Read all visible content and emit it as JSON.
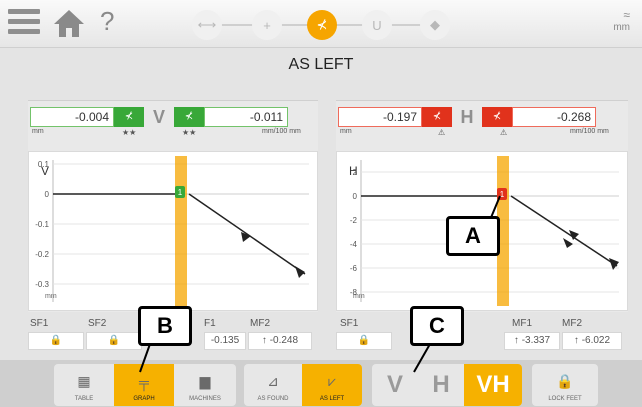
{
  "header": {
    "help": "?",
    "units": "mm",
    "steps": [
      "dimensions-icon",
      "sensor-position-icon",
      "results-icon",
      "coupling-icon",
      "settings-icon"
    ]
  },
  "title": "AS LEFT",
  "left_panel": {
    "value_left": "-0.004",
    "axis": "V",
    "value_right": "-0.011",
    "unit_left": "mm",
    "unit_right": "mm/100 mm",
    "stars_left": "★★",
    "stars_right": "★★",
    "plot_axis": "V",
    "plot_unit": "mm",
    "y_ticks": [
      "0.1",
      "0",
      "-0.1",
      "-0.2",
      "-0.3"
    ],
    "marker": "1"
  },
  "right_panel": {
    "value_left": "-0.197",
    "axis": "H",
    "value_right": "-0.268",
    "unit_left": "mm",
    "unit_right": "mm/100 mm",
    "warn_left": "⚠",
    "warn_right": "⚠",
    "plot_axis": "H",
    "plot_unit": "mm",
    "y_ticks": [
      "2",
      "0",
      "-2",
      "-4",
      "-6",
      "-8"
    ],
    "marker": "1"
  },
  "feet_left": {
    "sf1_label": "SF1",
    "sf2_label": "SF2",
    "mf1_label": "F1",
    "mf2_label": "MF2",
    "mf1_value": "-0.135",
    "mf2_value": "-0.248",
    "arrow": "↑"
  },
  "feet_right": {
    "sf1_label": "SF1",
    "mf1_label": "MF1",
    "mf2_label": "MF2",
    "mf1_value": "-3.337",
    "mf2_value": "-6.022",
    "arrow": "↑"
  },
  "toolbar": {
    "view_buttons": [
      {
        "label": "TABLE",
        "icon": "table-icon"
      },
      {
        "label": "GRAPH",
        "icon": "graph-icon",
        "active": true
      },
      {
        "label": "MACHINES",
        "icon": "machines-icon"
      }
    ],
    "state_buttons": [
      {
        "label": "AS FOUND",
        "icon": "as-found-icon"
      },
      {
        "label": "AS LEFT",
        "icon": "as-left-icon",
        "active": true
      }
    ],
    "axis_buttons": [
      {
        "label": "V"
      },
      {
        "label": "H"
      },
      {
        "label": "VH",
        "active": true
      }
    ],
    "lock_label": "LOCK FEET"
  },
  "callouts": {
    "a": "A",
    "b": "B",
    "c": "C"
  },
  "colors": {
    "accent": "#f6a500",
    "ok": "#38a838",
    "bad": "#e1321c"
  }
}
